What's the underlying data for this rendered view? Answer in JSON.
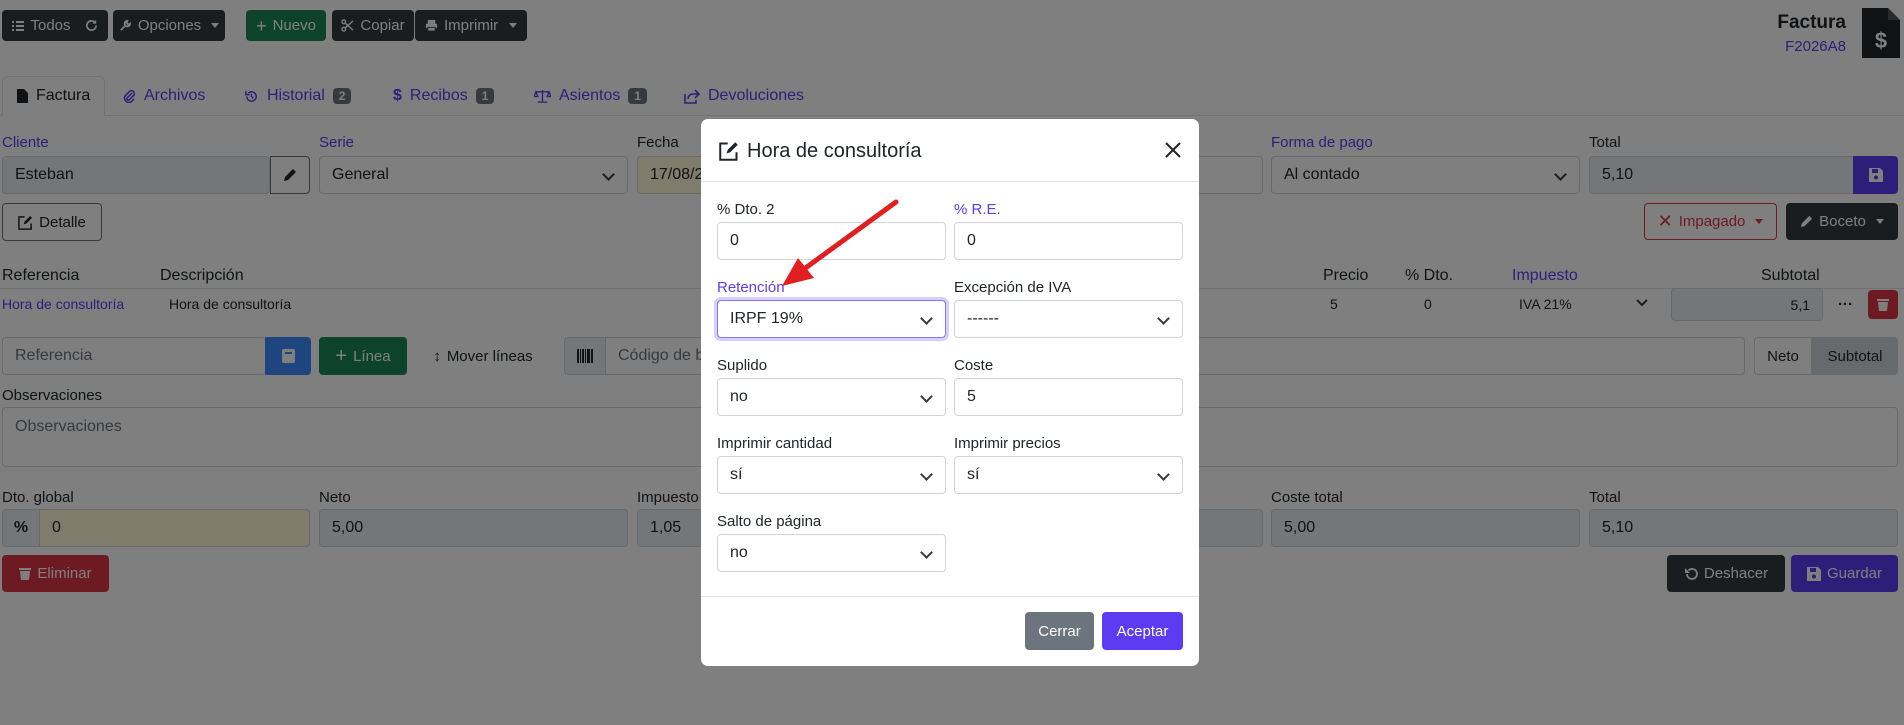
{
  "toolbar": {
    "all_label": "Todos",
    "options_label": "Opciones",
    "new_label": "Nuevo",
    "copy_label": "Copiar",
    "print_label": "Imprimir"
  },
  "doc": {
    "type": "Factura",
    "code": "F2026A8"
  },
  "tabs": [
    {
      "label": "Factura"
    },
    {
      "label": "Archivos"
    },
    {
      "label": "Historial",
      "badge": "2"
    },
    {
      "label": "Recibos",
      "badge": "1"
    },
    {
      "label": "Asientos",
      "badge": "1"
    },
    {
      "label": "Devoluciones"
    }
  ],
  "header_fields": {
    "client_label": "Cliente",
    "client_value": "Esteban",
    "series_label": "Serie",
    "series_value": "General",
    "date_label": "Fecha",
    "date_value": "17/08/2",
    "payment_label": "Forma de pago",
    "payment_value": "Al contado",
    "total_label": "Total",
    "total_value": "5,10"
  },
  "actions": {
    "detail_label": "Detalle",
    "unpaid_label": "Impagado",
    "draft_label": "Boceto"
  },
  "lines_table": {
    "headers": [
      "Referencia",
      "Descripción",
      "Precio",
      "% Dto.",
      "Impuesto",
      "Subtotal"
    ],
    "row": {
      "reference": "Hora de consultoría",
      "description": "Hora de consultoría",
      "price": "5",
      "discount": "0",
      "tax": "IVA 21%",
      "subtotal": "5,1"
    }
  },
  "line_tools": {
    "reference_placeholder": "Referencia",
    "add_line_label": "Línea",
    "move_lines_label": "Mover líneas",
    "barcode_placeholder": "Código de b",
    "net_label": "Neto",
    "subtotal_label": "Subtotal"
  },
  "observations": {
    "label": "Observaciones",
    "placeholder": "Observaciones"
  },
  "totals": {
    "global_discount_label": "Dto. global",
    "global_discount_value": "0",
    "net_label": "Neto",
    "net_value": "5,00",
    "taxes_label": "Impuesto",
    "taxes_value": "1,05",
    "total_cost_label": "Coste total",
    "total_cost_value": "5,00",
    "total_label": "Total",
    "total_value": "5,10"
  },
  "bottom_actions": {
    "delete_label": "Eliminar",
    "undo_label": "Deshacer",
    "save_label": "Guardar"
  },
  "modal": {
    "title": "Hora de consultoría",
    "fields": {
      "dto2_label": "% Dto. 2",
      "dto2_value": "0",
      "re_label": "% R.E.",
      "re_value": "0",
      "retention_label": "Retención",
      "retention_value": "IRPF 19%",
      "vat_exception_label": "Excepción de IVA",
      "vat_exception_value": "------",
      "supplied_label": "Suplido",
      "supplied_value": "no",
      "cost_label": "Coste",
      "cost_value": "5",
      "print_qty_label": "Imprimir cantidad",
      "print_qty_value": "sí",
      "print_prices_label": "Imprimir precios",
      "print_prices_value": "sí",
      "page_break_label": "Salto de página",
      "page_break_value": "no"
    },
    "close_label": "Cerrar",
    "accept_label": "Aceptar"
  },
  "colors": {
    "accent": "#5b3cf2",
    "success": "#198754",
    "danger": "#dc3545",
    "dark": "#343a40",
    "annotation": "#e02020"
  }
}
